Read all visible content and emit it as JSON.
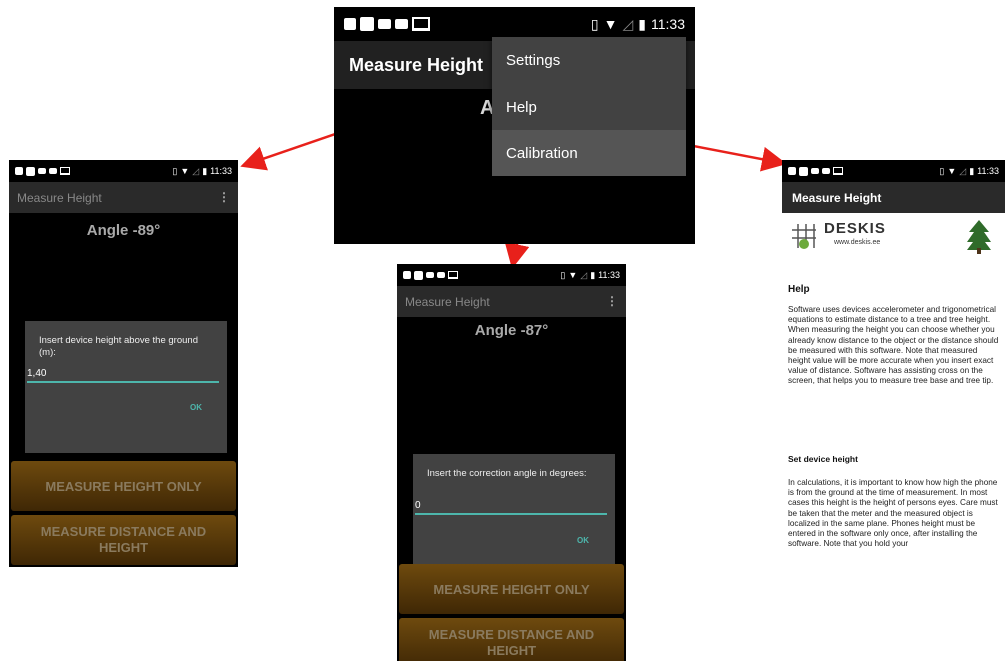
{
  "status_time": "11:33",
  "app_title": "Measure Height",
  "overflow_icon": "⋮",
  "center": {
    "angle_partial": "Ang",
    "menu": [
      {
        "label": "Settings"
      },
      {
        "label": "Help"
      },
      {
        "label": "Calibration"
      }
    ]
  },
  "left": {
    "angle": "Angle -89°",
    "dialog_message": "Insert device height above the ground (m):",
    "dialog_value": "1,40",
    "ok": "OK",
    "btn_height_only": "MEASURE HEIGHT ONLY",
    "btn_distance_height": "MEASURE DISTANCE AND HEIGHT"
  },
  "middle": {
    "angle": "Angle -87°",
    "dialog_message": "Insert the correction angle in degrees:",
    "dialog_value": "0",
    "ok": "OK",
    "btn_height_only": "MEASURE HEIGHT ONLY",
    "btn_distance_height": "MEASURE DISTANCE AND HEIGHT"
  },
  "right": {
    "logo_name": "DESKIS",
    "logo_url": "www.deskis.ee",
    "help_heading": "Help",
    "help_text": "Software uses devices accelerometer and trigonometrical equations to estimate distance to a tree and tree height. When measuring the height you can choose whether you already know distance to the object or the distance should be measured with this software. Note that measured height value will be more accurate when you insert exact value of distance. Software has assisting cross on the screen, that helps you to measure tree base and tree tip.",
    "set_heading": "Set device height",
    "set_text": "In calculations, it is important to know how high the phone is from the ground at the time of measurement. In most cases this height is the height of persons eyes. Care must be taken that the meter and the measured object is localized in the same plane. Phones height must be entered in the software only once, after installing the software. Note that you hold your"
  },
  "colors": {
    "accent": "#4db6ac",
    "arrow": "#e8211b",
    "button_brown": "#6e4a0e",
    "dialog_bg": "#424242"
  }
}
